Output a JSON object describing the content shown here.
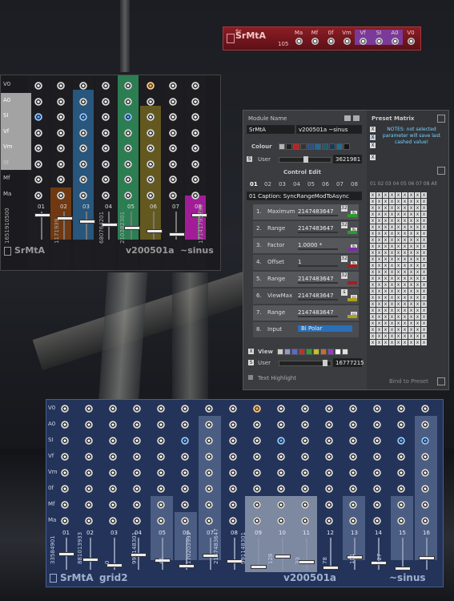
{
  "strip": {
    "brand": "SrMtA",
    "sr": "Sr",
    "number": "105",
    "ports": [
      "Ma",
      "Mf",
      "0f",
      "Vm",
      "Vf",
      "SI",
      "A0",
      "V0"
    ]
  },
  "panel1": {
    "row_labels": [
      "V0",
      "A0",
      "SI",
      "Vf",
      "Vm",
      "0f",
      "Mf",
      "Ma"
    ],
    "channels": [
      "01",
      "02",
      "03",
      "04",
      "05",
      "06",
      "07",
      "08"
    ],
    "vertical_values": [
      "1651910500",
      "1171939",
      "680764201",
      "210382301",
      "17141795399"
    ],
    "brand": "SrMtA",
    "version": "v200501a",
    "wave": "~sinus",
    "colors": {
      "orange": "#7a3d10",
      "blue": "#2a5d86",
      "green": "#2f8a58",
      "olive": "#6b6020",
      "magenta": "#b01ea5"
    }
  },
  "editor": {
    "module_name_label": "Module Name",
    "module_name_value": "SrMtA",
    "module_version_value": "v200501a ~sinus",
    "colour_label": "Colour",
    "user_label": "User",
    "user_value": "3621981",
    "control_edit_label": "Control Edit",
    "tabs": [
      "01",
      "02",
      "03",
      "04",
      "05",
      "06",
      "07",
      "08"
    ],
    "caption": "01  Caption: SyncRangeModToAsync",
    "rows": [
      {
        "n": "1.",
        "name": "Maximum",
        "value": "2147483647",
        "box": "32",
        "flag": "b",
        "led": "#2c9b2c"
      },
      {
        "n": "2.",
        "name": "Range",
        "value": "2147483647",
        "box": "32",
        "flag": "b",
        "led": "#2c9b2c"
      },
      {
        "n": "3.",
        "name": "Factor",
        "value": "1.0000 *",
        "box": "",
        "flag": "b",
        "led": "#7d2ea6"
      },
      {
        "n": "4.",
        "name": "Offset",
        "value": "1",
        "box": "32",
        "flag": "b",
        "led": "#a31f1f"
      },
      {
        "n": "5.",
        "name": "Range",
        "value": "2147483647",
        "box": "32",
        "flag": "",
        "led": "#a31f1f"
      },
      {
        "n": "6.",
        "name": "ViewMax",
        "value": "2147483647",
        "box": "s",
        "flag": "u",
        "led": "#b0a020"
      },
      {
        "n": "7.",
        "name": "Range",
        "value": "2147483647",
        "box": "",
        "flag": "u",
        "led": "#b0a020"
      },
      {
        "n": "8.",
        "name": "Input",
        "value": "Bi Polar",
        "box": "",
        "flag": "",
        "led": ""
      }
    ],
    "view_label": "View",
    "user2_label": "User",
    "user2_value": "16777215",
    "text_highlight_label": "Text Highlight",
    "preset_matrix_label": "Preset Matrix",
    "preset_note": "NOTES: not selected parameter will save last cashed value!",
    "preset_header": "01 02 03 04 05 06 07 08 All",
    "bind_label": "Bind to Preset",
    "swatch_colors": [
      "#b5b5b5",
      "#222222",
      "#c02020",
      "#333333",
      "#2a4f8a",
      "#1e6a9a",
      "#215a6a",
      "#1a3a5a",
      "#1b7090",
      "#151515"
    ],
    "view_colors": [
      "#cccccc",
      "#8a9ad0",
      "#5a6ad0",
      "#c03030",
      "#30a030",
      "#c0c030",
      "#c07030",
      "#9040c0",
      "#ffffff",
      "#e0e0e0"
    ]
  },
  "panel2": {
    "row_labels": [
      "V0",
      "A0",
      "SI",
      "Vf",
      "Vm",
      "0f",
      "Mf",
      "Ma"
    ],
    "channels": [
      "01",
      "02",
      "03",
      "04",
      "05",
      "06",
      "07",
      "08",
      "09",
      "10",
      "11",
      "12",
      "13",
      "14",
      "15",
      "16"
    ],
    "vertical_values": [
      "33584901",
      "881013933",
      "0",
      "991148301",
      "41",
      "170203991",
      "2147483647",
      "991148301",
      "128",
      "33",
      "78",
      "101",
      "127"
    ],
    "brand": "SrMtA",
    "grid": "grid2",
    "version": "v200501a",
    "wave": "~sinus"
  }
}
